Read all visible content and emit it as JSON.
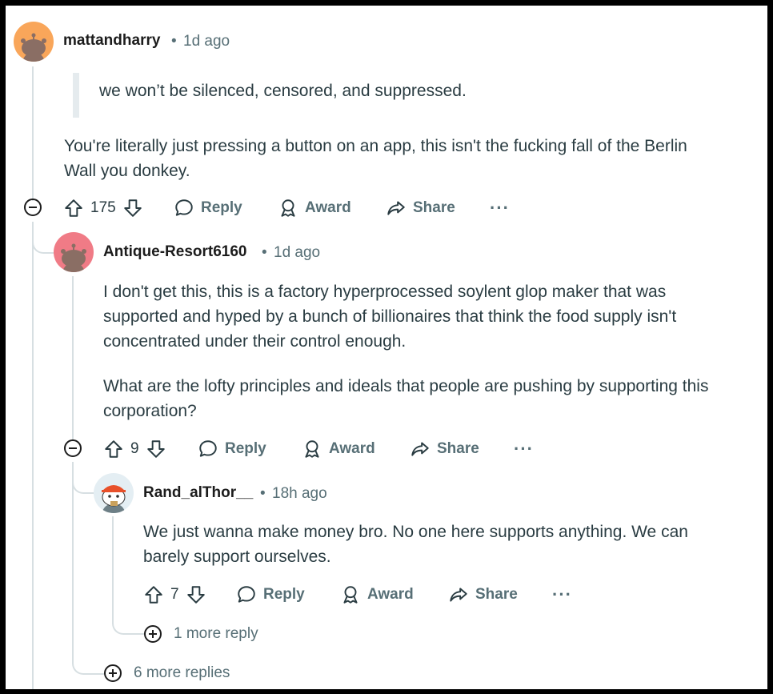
{
  "comments": [
    {
      "username": "mattandharry",
      "separator": "•",
      "time": "1d ago",
      "quote": "we won’t be silenced, censored, and suppressed.",
      "body_lines": [
        "You're literally just pressing a button on an app, this isn't the fucking fall of the Berlin",
        "Wall you donkey."
      ],
      "score": "175",
      "reply_label": "Reply",
      "award_label": "Award",
      "share_label": "Share",
      "more_label": "···",
      "avatar_color": "#f9a65a"
    },
    {
      "username": "Antique-Resort6160",
      "separator": "•",
      "time": "1d ago",
      "paragraph1_lines": [
        "I don't get this, this is a factory hyperprocessed soylent glop maker that was",
        "supported and hyped by a bunch of billionaires that think the food supply isn't",
        "concentrated under their control enough."
      ],
      "paragraph2_lines": [
        "What are the lofty principles and ideals that people are pushing by supporting this",
        "corporation?"
      ],
      "score": "9",
      "reply_label": "Reply",
      "award_label": "Award",
      "share_label": "Share",
      "more_label": "···",
      "avatar_color": "#f07b86"
    },
    {
      "username": "Rand_alThor__",
      "separator": "•",
      "time": "18h ago",
      "body_lines": [
        "We just wanna make money bro. No one here supports anything. We can",
        "barely support ourselves."
      ],
      "score": "7",
      "reply_label": "Reply",
      "award_label": "Award",
      "share_label": "Share",
      "more_label": "···"
    }
  ],
  "more_replies_nested": "1 more reply",
  "more_replies": "6 more replies",
  "colors": {
    "meta": "#576f76",
    "thread_line": "#d7dfe2",
    "text": "#2a3c42"
  }
}
